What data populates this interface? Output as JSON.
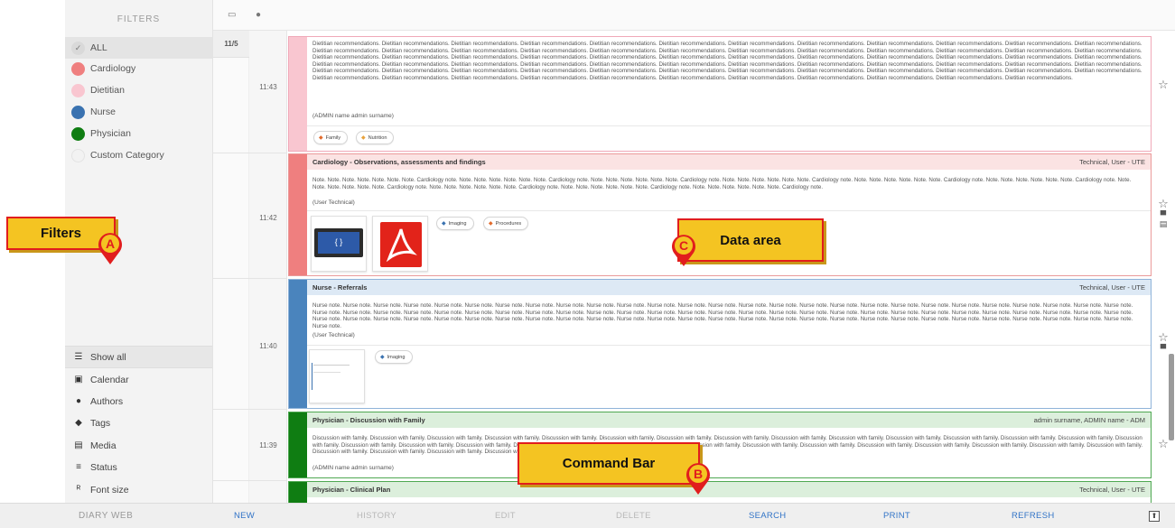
{
  "app_name": "DIARY WEB",
  "sidebar": {
    "title": "FILTERS",
    "filters": [
      {
        "label": "ALL",
        "color": "#d9d9d9",
        "active": true
      },
      {
        "label": "Cardiology",
        "color": "#ef7f7f"
      },
      {
        "label": "Dietitian",
        "color": "#f9c6d0"
      },
      {
        "label": "Nurse",
        "color": "#3a72b0"
      },
      {
        "label": "Physician",
        "color": "#0f7d12"
      },
      {
        "label": "Custom Category",
        "color": "#f2f2f2"
      }
    ],
    "tools": [
      {
        "label": "Show all",
        "icon": "filter-lines-icon"
      },
      {
        "label": "Calendar",
        "icon": "calendar-icon"
      },
      {
        "label": "Authors",
        "icon": "person-icon"
      },
      {
        "label": "Tags",
        "icon": "tag-icon"
      },
      {
        "label": "Media",
        "icon": "media-file-icon"
      },
      {
        "label": "Status",
        "icon": "status-icon"
      },
      {
        "label": "Font size",
        "icon": "font-size-icon"
      }
    ]
  },
  "date_column": {
    "date": "11/5"
  },
  "entries": [
    {
      "time": "11:43",
      "title": "",
      "author": "",
      "category": "Dietitian",
      "stripe_color": "#f9c6d0",
      "border_color": "#f0a8b8",
      "text": "Dietitian recommendations. Dietitian recommendations. Dietitian recommendations. Dietitian recommendations. Dietitian recommendations. Dietitian recommendations. Dietitian recommendations. Dietitian recommendations. Dietitian recommendations. Dietitian recommendations. Dietitian recommendations. Dietitian recommendations. Dietitian recommendations. Dietitian recommendations. Dietitian recommendations. Dietitian recommendations. Dietitian recommendations. Dietitian recommendations. Dietitian recommendations. Dietitian recommendations. Dietitian recommendations. Dietitian recommendations. Dietitian recommendations. Dietitian recommendations. Dietitian recommendations. Dietitian recommendations. Dietitian recommendations. Dietitian recommendations. Dietitian recommendations. Dietitian recommendations. Dietitian recommendations. Dietitian recommendations. Dietitian recommendations. Dietitian recommendations. Dietitian recommendations. Dietitian recommendations. Dietitian recommendations. Dietitian recommendations. Dietitian recommendations. Dietitian recommendations. Dietitian recommendations. Dietitian recommendations. Dietitian recommendations. Dietitian recommendations. Dietitian recommendations. Dietitian recommendations. Dietitian recommendations. Dietitian recommendations. Dietitian recommendations. Dietitian recommendations. Dietitian recommendations. Dietitian recommendations. Dietitian recommendations. Dietitian recommendations. Dietitian recommendations. Dietitian recommendations. Dietitian recommendations. Dietitian recommendations. Dietitian recommendations. Dietitian recommendations. Dietitian recommendations. Dietitian recommendations. Dietitian recommendations. Dietitian recommendations. Dietitian recommendations. Dietitian recommendations. Dietitian recommendations. Dietitian recommendations. Dietitian recommendations. Dietitian recommendations. Dietitian recommendations.",
      "signature": "(ADMIN name admin surname)",
      "tags": [
        "Family",
        "Nutrition"
      ]
    },
    {
      "time": "11:42",
      "title": "Cardiology - Observations, assessments and findings",
      "author": "Technical, User - UTE",
      "category": "Cardiology",
      "stripe_color": "#ef7f7f",
      "border_color": "#ea9a9a",
      "head_bg": "#fbe3e3",
      "text": "Note. Note. Note. Note. Note. Note. Note. Cardiology note. Note. Note. Note. Note. Note. Note. Cardiology note. Note. Note. Note. Note. Note. Note. Cardiology note. Note. Note. Note. Note. Note. Note. Cardiology note. Note. Note. Note. Note. Note. Note. Cardiology note. Note. Note. Note. Note. Note. Note. Cardiology note. Note. Note. Note. Note. Note. Note. Cardiology note. Note. Note. Note. Note. Note. Note. Cardiology note. Note. Note. Note. Note. Note. Note. Cardiology note. Note. Note. Note. Note. Note. Note. Cardiology note.",
      "signature": "(User Technical)",
      "tags": [
        "Imaging",
        "Procedures"
      ]
    },
    {
      "time": "11:40",
      "title": "Nurse - Referrals",
      "author": "Technical, User - UTE",
      "category": "Nurse",
      "stripe_color": "#4a84bd",
      "border_color": "#8fb3d9",
      "head_bg": "#dde9f5",
      "text": "Nurse note. Nurse note. Nurse note. Nurse note. Nurse note. Nurse note. Nurse note. Nurse note. Nurse note. Nurse note. Nurse note. Nurse note. Nurse note. Nurse note. Nurse note. Nurse note. Nurse note. Nurse note. Nurse note. Nurse note. Nurse note. Nurse note. Nurse note. Nurse note. Nurse note. Nurse note. Nurse note. Nurse note. Nurse note. Nurse note. Nurse note. Nurse note. Nurse note. Nurse note. Nurse note. Nurse note. Nurse note. Nurse note. Nurse note. Nurse note. Nurse note. Nurse note. Nurse note. Nurse note. Nurse note. Nurse note. Nurse note. Nurse note. Nurse note. Nurse note. Nurse note. Nurse note. Nurse note. Nurse note. Nurse note. Nurse note. Nurse note. Nurse note. Nurse note. Nurse note. Nurse note. Nurse note. Nurse note. Nurse note. Nurse note. Nurse note. Nurse note. Nurse note. Nurse note. Nurse note. Nurse note. Nurse note. Nurse note. Nurse note. Nurse note. Nurse note. Nurse note. Nurse note. Nurse note. Nurse note. Nurse note. Nurse note.",
      "signature": "(User Technical)",
      "tags": [
        "Imaging"
      ]
    },
    {
      "time": "11:39",
      "title": "Physician - Discussion with Family",
      "author": "admin surname, ADMIN name - ADM",
      "category": "Physician",
      "stripe_color": "#0f7d12",
      "border_color": "#4fa852",
      "head_bg": "#dcefdc",
      "text": "Discussion with family. Discussion with family. Discussion with family. Discussion with family. Discussion with family. Discussion with family. Discussion with family. Discussion with family. Discussion with family. Discussion with family. Discussion with family. Discussion with family. Discussion with family. Discussion with family. Discussion with family. Discussion with family. Discussion with family. Discussion with family. Discussion with family. Discussion with family. Discussion with family. Discussion with family. Discussion with family. Discussion with family. Discussion with family. Discussion with family. Discussion with family. Discussion with family. Discussion with family. Discussion with family. Discussion with family. Discussion with family. Discussion with family. Discussion with family.",
      "signature": "(ADMIN name admin surname)",
      "tags": []
    },
    {
      "time": "",
      "title": "Physician - Clinical Plan",
      "author": "Technical, User - UTE",
      "category": "Physician",
      "stripe_color": "#0f7d12",
      "border_color": "#4fa852",
      "head_bg": "#dcefdc",
      "text": "",
      "signature": "",
      "tags": []
    }
  ],
  "commands": [
    {
      "label": "NEW",
      "enabled": true
    },
    {
      "label": "HISTORY",
      "enabled": false
    },
    {
      "label": "EDIT",
      "enabled": false
    },
    {
      "label": "DELETE",
      "enabled": false
    },
    {
      "label": "SEARCH",
      "enabled": true
    },
    {
      "label": "PRINT",
      "enabled": true
    },
    {
      "label": "REFRESH",
      "enabled": true
    }
  ],
  "callouts": {
    "a": {
      "label": "Filters",
      "letter": "A"
    },
    "b": {
      "label": "Command Bar",
      "letter": "B"
    },
    "c": {
      "label": "Data area",
      "letter": "C"
    }
  },
  "colors": {
    "accent_blue": "#3274c7",
    "callout_fill": "#f4c422",
    "callout_border": "#e11d1d"
  }
}
